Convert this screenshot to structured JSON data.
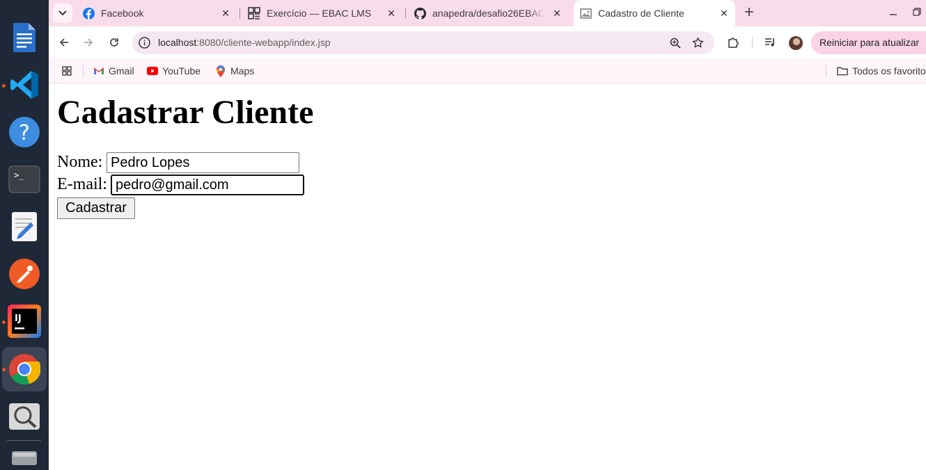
{
  "dock": {
    "apps": [
      {
        "name": "LibreOffice Writer",
        "icon": "writer-document-icon"
      },
      {
        "name": "Visual Studio Code",
        "icon": "vscode-icon"
      },
      {
        "name": "Help",
        "icon": "help-icon"
      },
      {
        "name": "Terminal",
        "icon": "terminal-icon"
      },
      {
        "name": "Text Editor",
        "icon": "text-editor-icon"
      },
      {
        "name": "Postman",
        "icon": "postman-icon"
      },
      {
        "name": "IntelliJ IDEA",
        "icon": "intellij-icon",
        "label": "IJ"
      },
      {
        "name": "Google Chrome",
        "icon": "chrome-icon"
      },
      {
        "name": "Image Viewer",
        "icon": "magnifier-icon"
      },
      {
        "name": "Files",
        "icon": "drive-icon"
      }
    ]
  },
  "browser": {
    "tabs": [
      {
        "title": "Facebook",
        "icon": "facebook-icon",
        "active": false
      },
      {
        "title": "Exercício — EBAC LMS",
        "icon": "ebac-icon",
        "active": false
      },
      {
        "title": "anapedra/desafio26EBAC",
        "icon": "github-icon",
        "active": false
      },
      {
        "title": "Cadastro de Cliente",
        "icon": "page-icon",
        "active": true
      }
    ],
    "url": {
      "host": "localhost",
      "path": ":8080/cliente-webapp/index.jsp"
    },
    "update_button": "Reiniciar para atualizar",
    "bookmarks": [
      {
        "label": "Gmail",
        "icon": "gmail-icon"
      },
      {
        "label": "YouTube",
        "icon": "youtube-icon"
      },
      {
        "label": "Maps",
        "icon": "maps-icon"
      }
    ],
    "all_bookmarks": "Todos os favoritos"
  },
  "page": {
    "title": "Cadastrar Cliente",
    "form": {
      "name_label": "Nome:",
      "name_value": "Pedro Lopes",
      "email_label": "E-mail:",
      "email_value": "pedro@gmail.com",
      "submit_label": "Cadastrar"
    }
  },
  "colors": {
    "tabstrip": "#f9dcea",
    "dock": "#1e2837",
    "update_button": "#fbd3e6"
  }
}
